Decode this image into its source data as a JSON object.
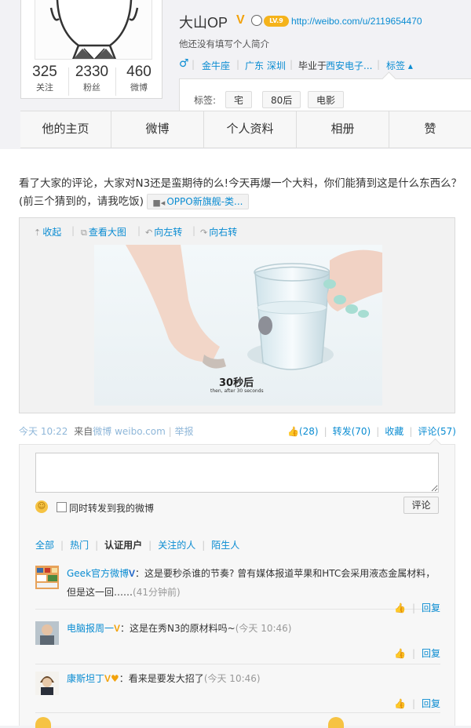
{
  "profile": {
    "name": "大山OP",
    "level_badge": "LV.9",
    "url": "http://weibo.com/u/2119654470",
    "bio": "他还没有填写个人简介",
    "stats": [
      {
        "num": "325",
        "label": "关注"
      },
      {
        "num": "2330",
        "label": "粉丝"
      },
      {
        "num": "460",
        "label": "微博"
      }
    ],
    "gender_icon": "♂",
    "zodiac": "金牛座",
    "location": "广东 深圳",
    "edu_prefix": "毕业于",
    "school": "西安电子...",
    "tags_toggle": "标签 ▴",
    "tags_label": "标签:",
    "tags": [
      "宅",
      "80后",
      "电影"
    ]
  },
  "tabs": [
    "他的主页",
    "微博",
    "个人资料",
    "相册",
    "赞"
  ],
  "post": {
    "text": "看了大家的评论，大家对N3还是蛮期待的么!今天再爆一个大料，你们能猜到这是什么东西么？(前三个猜到的，请我吃饭)",
    "video_link": "OPPO新旗舰-类...",
    "media_tools": [
      "收起",
      "查看大图",
      "向左转",
      "向右转"
    ],
    "photo_caption_cn": "30秒后",
    "photo_caption_en": "then, after 30 seconds",
    "time": "今天 10:22",
    "from_label": "来自",
    "source": "微博 weibo.com",
    "report": "举报",
    "likes": "(28)",
    "forward": "转发(70)",
    "favorite": "收藏",
    "comments": "评论(57)"
  },
  "comment_box": {
    "placeholder": "",
    "also_forward": "同时转发到我的微博",
    "submit": "评论",
    "filters": [
      "全部",
      "热门",
      "认证用户",
      "关注的人",
      "陌生人"
    ]
  },
  "comments": [
    {
      "name": "Geek官方微博",
      "text": "：这是要秒杀谁的节奏? 曾有媒体报道苹果和HTC会采用液态金属材料，但是这一回……",
      "time": "(41分钟前)",
      "reply": "回复"
    },
    {
      "name": "电脑报周一",
      "text": "：这是在秀N3的原材料吗~",
      "time": "(今天 10:46)",
      "reply": "回复"
    },
    {
      "name": "康斯坦丁",
      "text": "：看来是要发大招了",
      "time": "(今天 10:46)",
      "reply": "回复"
    }
  ],
  "colors": {
    "link": "#0a8cd2",
    "verified": "#f2a20b",
    "bg": "#f2f2f5"
  }
}
